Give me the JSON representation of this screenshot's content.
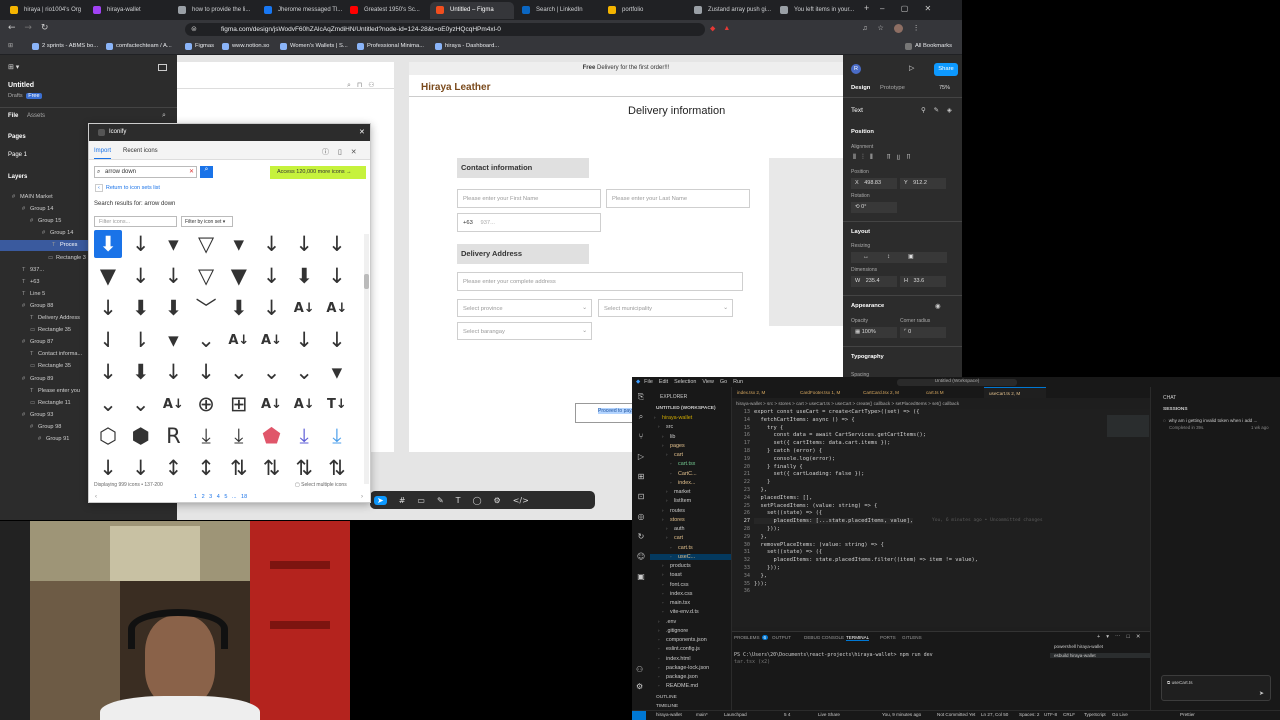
{
  "browser": {
    "tabs": [
      {
        "title": "hiraya | rio1004's Org",
        "color": "#f4b400"
      },
      {
        "title": "hiraya-wallet",
        "color": "#a142f4"
      },
      {
        "title": "how to provide the li...",
        "color": "#9aa0a6"
      },
      {
        "title": "Jherome messaged Tl...",
        "color": "#1877f2"
      },
      {
        "title": "Greatest 1950's Sc...",
        "color": "#ff0000"
      },
      {
        "title": "Untitled – Figma",
        "color": "#f24e1e"
      },
      {
        "title": "Search | LinkedIn",
        "color": "#0a66c2"
      },
      {
        "title": "portfolio",
        "color": "#f4b400"
      },
      {
        "title": "Zustand array push gi...",
        "color": "#9aa0a6"
      },
      {
        "title": "You left items in your...",
        "color": "#9aa0a6"
      }
    ],
    "url": "figma.com/design/jsWodvF60hZAlcAqZmdiHN/Untitled?node-id=124-28&t=oE0yzHQcqHPm4xl-0",
    "bookmarks": [
      "2 sprints - ABMS bo...",
      "comfactechteam / A...",
      "Figmas",
      "www.notion.so",
      "Women's Wallets | S...",
      "Professional Minima...",
      "hiraya - Dashboard..."
    ],
    "all_bookmarks": "All Bookmarks"
  },
  "figma": {
    "file_name": "Untitled",
    "drafts": "Drafts",
    "plan": "Free",
    "tab_file": "File",
    "tab_assets": "Assets",
    "pages_label": "Pages",
    "page1": "Page 1",
    "layers_label": "Layers",
    "layers": [
      "MAIN Market",
      "Group 14",
      "Group 15",
      "Group 14",
      "Proces",
      "Rectangle 3",
      "937...",
      "+63",
      "Line 5",
      "Group 88",
      "Delivery Address",
      "Rectangle 35",
      "Group 87",
      "Contact informa...",
      "Rectangle 35",
      "Group 89",
      "Please enter you",
      "Rectangle 11",
      "Group 93",
      "Group 98",
      "Group 91"
    ],
    "right": {
      "avatar": "R",
      "share": "Share",
      "tab_design": "Design",
      "tab_prototype": "Prototype",
      "zoom": "75%",
      "text_label": "Text",
      "position": "Position",
      "alignment": "Alignment",
      "position_sub": "Position",
      "x": "498.83",
      "y": "912.2",
      "rotation": "Rotation",
      "rot_val": "0°",
      "layout": "Layout",
      "resizing": "Resizing",
      "dimensions": "Dimensions",
      "w": "235.4",
      "h": "33.6",
      "appearance": "Appearance",
      "opacity_label": "Opacity",
      "corner_label": "Corner radius",
      "opacity": "100%",
      "corner": "0",
      "typography": "Typography",
      "spacing": "Spacing"
    }
  },
  "canvas": {
    "promo_bold": "Free",
    "promo_rest": " Delivery for the first order!!!",
    "brand": "Hiraya Leather",
    "heading": "Delivery information",
    "contact_title": "Contact information",
    "first_name": "Please enter your First Name",
    "last_name": "Please enter your Last Name",
    "country_code": "+63",
    "phone": "937...",
    "delivery_title": "Delivery Address",
    "address": "Please enter your complete address",
    "province": "Select province",
    "municipality": "Select municipality",
    "barangay": "Select barangay",
    "proceed": "Proceed to pay..."
  },
  "iconify": {
    "title": "Iconify",
    "tab_import": "Import",
    "tab_recent": "Recent icons",
    "search_value": "arrow down",
    "access_more": "Access 120,000 more icons",
    "return_link": "Return to icon sets list",
    "results_label": "Search results for: arrow down",
    "filter_placeholder": "Filter icons...",
    "filter_set": "Filter by icon set",
    "displaying": "Displaying 999 icons",
    "range": "137-200",
    "pages": "1 2 3 4 5 ... 18",
    "select_multiple": "Select multiple icons",
    "glyphs": [
      "⬇",
      "↓",
      "▾",
      "▽",
      "▾",
      "↓",
      "↓",
      "↓",
      "▼",
      "↓",
      "↓",
      "▽",
      "▼",
      "↓",
      "⬇",
      "↓",
      "↓",
      "⬇",
      "⬇",
      "﹀",
      "⬇",
      "↓",
      "A↓",
      "A↓",
      "⇃",
      "⇂",
      "▾",
      "⌄",
      "A↓",
      "A↓",
      "↓",
      "↓",
      "↓",
      "⬇",
      "↓",
      "↓",
      "⌄",
      "⌄",
      "⌄",
      "▾",
      "⌄",
      "⌄",
      "A↓",
      "⊕",
      "⊞",
      "A↓",
      "A↓",
      "T↓",
      "⬡",
      "⬢",
      "R",
      "⤓",
      "⤓",
      "⬟",
      "⤓",
      "⤓",
      "↓",
      "↓",
      "↕",
      "↕",
      "⇅",
      "⇅",
      "⇅",
      "⇅"
    ]
  },
  "vscode": {
    "title": "Untitled (Workspace)",
    "menu": [
      "File",
      "Edit",
      "Selection",
      "View",
      "Go",
      "Run"
    ],
    "explorer": "EXPLORER",
    "workspace": "UNTITLED (WORKSPACE)",
    "tabs": [
      "index.tsx 2, M",
      "CardFooter.tsx 1, M",
      "CartCard.tsx 2, M",
      "cart.ts M",
      "useCart.ts 2, M"
    ],
    "breadcrumb": "hiraya-wallet > src > stores > cart > useCart.ts > useCart > create() callback > setPlacedItems > set() callback",
    "find_value": "useCart",
    "find_count": "? of 1",
    "tree": [
      "hiraya-wallet",
      "src",
      "lib",
      "pages",
      "cart",
      "cart.tsx",
      "CartC...",
      "index...",
      "market",
      "listItem",
      "routes",
      "stores",
      "auth",
      "cart",
      "cart.ts",
      "useC...",
      "products",
      "toast",
      "font.css",
      "index.css",
      "main.tsx",
      "vite-env.d.ts",
      ".env",
      ".gitignore",
      "components.json",
      "eslint.config.js",
      "index.html",
      "package-lock.json",
      "package.json",
      "README.md"
    ],
    "outline": "OUTLINE",
    "timeline": "TIMELINE",
    "line_numbers": [
      "13",
      "14",
      "15",
      "16",
      "17",
      "18",
      "19",
      "20",
      "21",
      "22",
      "23",
      "24",
      "25",
      "26",
      "27",
      "28",
      "29",
      "30",
      "31",
      "32",
      "33",
      "34",
      "35",
      "36"
    ],
    "code_lines": [
      "export const useCart = create<CartType>((set) => ({",
      "  fetchCartItems: async () => {",
      "    try {",
      "      const data = await CartServices.getCartItems();",
      "      set({ cartItems: data.cart.items });",
      "    } catch (error) {",
      "      console.log(error);",
      "    } finally {",
      "      set({ cartLoading: false });",
      "    }",
      "  },",
      "  placedItems: [],",
      "  setPlacedItems: (value: string) => {",
      "    set((state) => ({",
      "      placedItems: [...state.placedItems, value],",
      "    }));",
      "  },",
      "  removePlaceItems: (value: string) => {",
      "    set((state) => ({",
      "      placedItems: state.placedItems.filter((item) => item != value),",
      "    }));",
      "  },",
      "}));",
      ""
    ],
    "blame": "You, 6 minutes ago • Uncommitted changes",
    "panel_tabs": [
      "PROBLEMS",
      "OUTPUT",
      "DEBUG CONSOLE",
      "TERMINAL",
      "PORTS",
      "GITLENS"
    ],
    "problems_count": "6",
    "terminal_line1": "PS C:\\Users\\20\\Documents\\react-projects\\hiraya-wallet> npm run dev",
    "terminal_line2": "tar.tsx (x2)",
    "terminals": [
      "powershell hiraya-wallet",
      "esbuild hiraya-wallet"
    ],
    "chat_label": "CHAT",
    "sessions": "SESSIONS",
    "chat_q": "why am i getting invalid token when i add ...",
    "chat_time": "1 wk ago",
    "chat_done": "Completed in 39s.",
    "chat_input": "useCart.ts",
    "status": [
      "hiraya-wallet",
      "main*",
      "Launchpad",
      "5  4",
      "Live Share",
      "You, 9 minutes ago",
      "Not Committed Yet",
      "Ln 27, Col 50",
      "Spaces: 2",
      "UTF-8",
      "CRLF",
      "TypeScript",
      "Go Live",
      "Prettier"
    ]
  }
}
